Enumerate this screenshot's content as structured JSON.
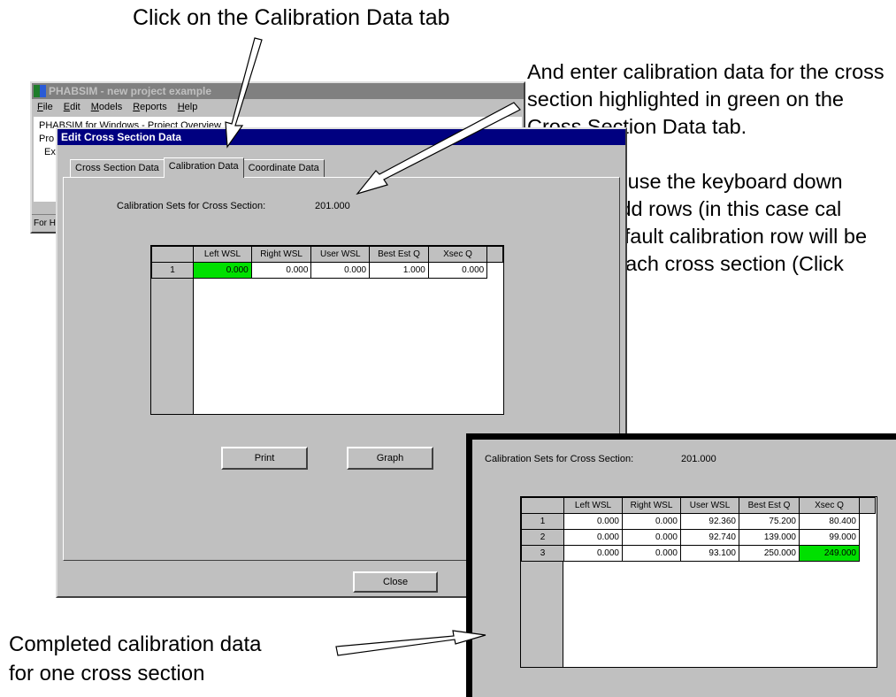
{
  "captions": {
    "top": "Click on the Calibration Data tab",
    "right": [
      "And enter calibration data for the cross section highlighted in green on the Cross Section Data tab.",
      "Here also, use the keyboard down arrow to add rows (in this case cal sets). A default calibration row will be added to each cross section (Click yes)."
    ],
    "bottom_line1": "Completed calibration data",
    "bottom_line2": "for one cross section"
  },
  "main_window": {
    "title": "PHABSIM - new project example",
    "menu": [
      "File",
      "Edit",
      "Models",
      "Reports",
      "Help"
    ],
    "client_lines": [
      "PHABSIM for Windows - Project Overview",
      "Pro",
      "Ex"
    ],
    "status": "For Help"
  },
  "dialog": {
    "title": "Edit Cross Section Data",
    "tabs": [
      "Cross Section Data",
      "Calibration Data",
      "Coordinate Data"
    ],
    "active_tab": "Calibration Data",
    "calset_label": "Calibration Sets for Cross Section:",
    "calset_value": "201.000",
    "columns": [
      "Left WSL",
      "Right WSL",
      "User WSL",
      "Best Est Q",
      "Xsec Q"
    ],
    "rows": [
      {
        "n": "1",
        "cells": [
          "0.000",
          "0.000",
          "0.000",
          "1.000",
          "0.000"
        ]
      }
    ],
    "highlight_column": 0,
    "print_label": "Print",
    "graph_label": "Graph",
    "close_label": "Close"
  },
  "inset": {
    "calset_label": "Calibration Sets for Cross Section:",
    "calset_value": "201.000",
    "columns": [
      "Left WSL",
      "Right WSL",
      "User WSL",
      "Best Est Q",
      "Xsec Q"
    ],
    "rows": [
      {
        "n": "1",
        "cells": [
          "0.000",
          "0.000",
          "92.360",
          "75.200",
          "80.400"
        ]
      },
      {
        "n": "2",
        "cells": [
          "0.000",
          "0.000",
          "92.740",
          "139.000",
          "99.000"
        ]
      },
      {
        "n": "3",
        "cells": [
          "0.000",
          "0.000",
          "93.100",
          "250.000",
          "249.000"
        ]
      }
    ],
    "highlight": {
      "row": 2,
      "col": 4
    }
  },
  "colors": {
    "highlight": "#00e000",
    "title_active": "#000080",
    "title_inactive": "#808080",
    "face": "#c0c0c0"
  }
}
